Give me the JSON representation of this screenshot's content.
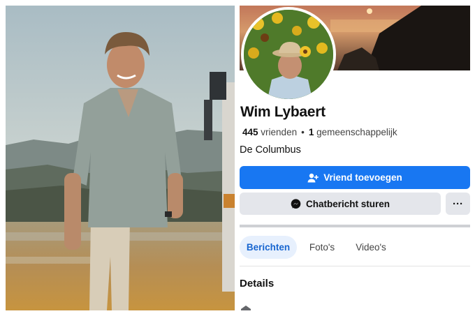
{
  "profile": {
    "name": "Wim Lybaert",
    "stats": {
      "friends_count": "445",
      "friends_label": "vrienden",
      "separator": "•",
      "mutual_count": "1",
      "mutual_label": "gemeenschappelijk"
    },
    "workplace": "De Columbus",
    "buttons": {
      "add_friend": "Vriend toevoegen",
      "message": "Chatbericht sturen",
      "more": "···"
    },
    "tabs": [
      {
        "label": "Berichten",
        "active": true
      },
      {
        "label": "Foto's",
        "active": false
      },
      {
        "label": "Video's",
        "active": false
      }
    ],
    "details_heading": "Details"
  },
  "colors": {
    "primary": "#1877f2",
    "secondary_button": "#e4e6eb",
    "active_tab_bg": "#e7f0fd",
    "active_tab_text": "#1866d0"
  },
  "icons": {
    "add_friend": "person-plus-icon",
    "message": "messenger-icon",
    "more": "ellipsis-icon",
    "details_row": "home-icon"
  }
}
